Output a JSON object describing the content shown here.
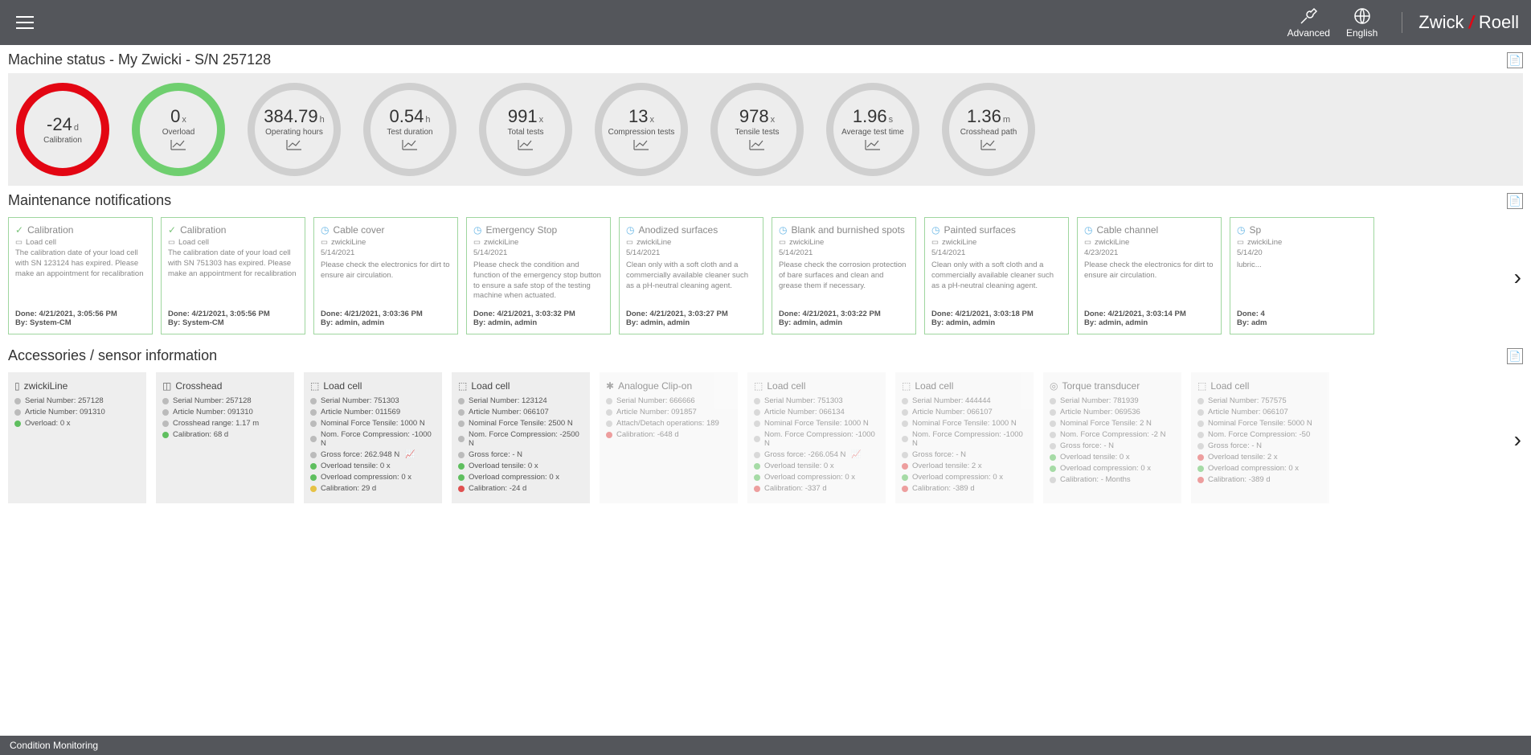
{
  "header": {
    "advanced": "Advanced",
    "language": "English",
    "logo_left": "Zwick",
    "logo_right": "Roell"
  },
  "status": {
    "title": "Machine status - My Zwicki - S/N 257128",
    "gauges": [
      {
        "value": "-24",
        "unit": "d",
        "label": "Calibration",
        "color": "red"
      },
      {
        "value": "0",
        "unit": "x",
        "label": "Overload",
        "color": "green",
        "icon": true
      },
      {
        "value": "384.79",
        "unit": "h",
        "label": "Operating hours",
        "color": "grey",
        "icon": true
      },
      {
        "value": "0.54",
        "unit": "h",
        "label": "Test duration",
        "color": "grey",
        "icon": true
      },
      {
        "value": "991",
        "unit": "x",
        "label": "Total tests",
        "color": "grey",
        "icon": true
      },
      {
        "value": "13",
        "unit": "x",
        "label": "Compression tests",
        "color": "grey",
        "icon": true
      },
      {
        "value": "978",
        "unit": "x",
        "label": "Tensile tests",
        "color": "grey",
        "icon": true
      },
      {
        "value": "1.96",
        "unit": "s",
        "label": "Average test time",
        "color": "grey",
        "icon": true
      },
      {
        "value": "1.36",
        "unit": "m",
        "label": "Crosshead path",
        "color": "grey",
        "icon": true
      }
    ]
  },
  "notifications": {
    "title": "Maintenance notifications",
    "items": [
      {
        "icon": "ok",
        "title": "Calibration",
        "sub": "Load cell",
        "date": "",
        "desc": "The calibration date of your load cell with SN 123124 has expired. Please make an appointment for recalibration",
        "done": "Done: 4/21/2021, 3:05:56 PM",
        "by": "By: System-CM"
      },
      {
        "icon": "ok",
        "title": "Calibration",
        "sub": "Load cell",
        "date": "",
        "desc": "The calibration date of your load cell with SN 751303 has expired. Please make an appointment for recalibration",
        "done": "Done: 4/21/2021, 3:05:56 PM",
        "by": "By: System-CM"
      },
      {
        "icon": "clock",
        "title": "Cable cover",
        "sub": "zwickiLine",
        "date": "5/14/2021",
        "desc": "Please check the electronics for dirt to ensure air circulation.",
        "done": "Done: 4/21/2021, 3:03:36 PM",
        "by": "By: admin, admin"
      },
      {
        "icon": "clock",
        "title": "Emergency Stop",
        "sub": "zwickiLine",
        "date": "5/14/2021",
        "desc": "Please check the condition and function of the emergency stop button to ensure a safe stop of the testing machine when actuated.",
        "done": "Done: 4/21/2021, 3:03:32 PM",
        "by": "By: admin, admin"
      },
      {
        "icon": "clock",
        "title": "Anodized surfaces",
        "sub": "zwickiLine",
        "date": "5/14/2021",
        "desc": "Clean only with a soft cloth and a commercially available cleaner such as a pH-neutral cleaning agent.",
        "done": "Done: 4/21/2021, 3:03:27 PM",
        "by": "By: admin, admin"
      },
      {
        "icon": "clock",
        "title": "Blank and burnished spots",
        "sub": "zwickiLine",
        "date": "5/14/2021",
        "desc": "Please check the corrosion protection of bare surfaces and clean and grease them if necessary.",
        "done": "Done: 4/21/2021, 3:03:22 PM",
        "by": "By: admin, admin"
      },
      {
        "icon": "clock",
        "title": "Painted surfaces",
        "sub": "zwickiLine",
        "date": "5/14/2021",
        "desc": "Clean only with a soft cloth and a commercially available cleaner such as a pH-neutral cleaning agent.",
        "done": "Done: 4/21/2021, 3:03:18 PM",
        "by": "By: admin, admin"
      },
      {
        "icon": "clock",
        "title": "Cable channel",
        "sub": "zwickiLine",
        "date": "4/23/2021",
        "desc": "Please check the electronics for dirt to ensure air circulation.",
        "done": "Done: 4/21/2021, 3:03:14 PM",
        "by": "By: admin, admin"
      },
      {
        "icon": "clock",
        "title": "Sp",
        "sub": "zwickiLine",
        "date": "5/14/20",
        "desc": "lubric...",
        "done": "Done: 4",
        "by": "By: adm"
      }
    ]
  },
  "accessories": {
    "title": "Accessories / sensor information",
    "items": [
      {
        "dim": false,
        "icon": "machine",
        "title": "zwickiLine",
        "rows": [
          {
            "c": "grey",
            "t": "Serial Number: 257128"
          },
          {
            "c": "grey",
            "t": "Article Number: 091310"
          },
          {
            "c": "green",
            "t": "Overload: 0 x"
          }
        ]
      },
      {
        "dim": false,
        "icon": "crosshead",
        "title": "Crosshead",
        "rows": [
          {
            "c": "grey",
            "t": "Serial Number: 257128"
          },
          {
            "c": "grey",
            "t": "Article Number: 091310"
          },
          {
            "c": "grey",
            "t": "Crosshead range: 1.17 m"
          },
          {
            "c": "green",
            "t": "Calibration: 68 d"
          }
        ]
      },
      {
        "dim": false,
        "icon": "loadcell",
        "title": "Load cell",
        "rows": [
          {
            "c": "grey",
            "t": "Serial Number: 751303"
          },
          {
            "c": "grey",
            "t": "Article Number: 011569"
          },
          {
            "c": "grey",
            "t": "Nominal Force Tensile: 1000 N"
          },
          {
            "c": "grey",
            "t": "Nom. Force Compression: -1000 N"
          },
          {
            "c": "grey",
            "t": "Gross force: 262.948 N",
            "chart": true
          },
          {
            "c": "green",
            "t": "Overload tensile: 0 x"
          },
          {
            "c": "green",
            "t": "Overload compression: 0 x"
          },
          {
            "c": "yellow",
            "t": "Calibration: 29 d"
          }
        ]
      },
      {
        "dim": false,
        "icon": "loadcell",
        "title": "Load cell",
        "rows": [
          {
            "c": "grey",
            "t": "Serial Number: 123124"
          },
          {
            "c": "grey",
            "t": "Article Number: 066107"
          },
          {
            "c": "grey",
            "t": "Nominal Force Tensile: 2500 N"
          },
          {
            "c": "grey",
            "t": "Nom. Force Compression: -2500 N"
          },
          {
            "c": "grey",
            "t": "Gross force: - N"
          },
          {
            "c": "green",
            "t": "Overload tensile: 0 x"
          },
          {
            "c": "green",
            "t": "Overload compression: 0 x"
          },
          {
            "c": "red",
            "t": "Calibration: -24 d"
          }
        ]
      },
      {
        "dim": true,
        "icon": "clipon",
        "title": "Analogue Clip-on",
        "rows": [
          {
            "c": "grey",
            "t": "Serial Number: 666666"
          },
          {
            "c": "grey",
            "t": "Article Number: 091857"
          },
          {
            "c": "grey",
            "t": "Attach/Detach operations: 189"
          },
          {
            "c": "red",
            "t": "Calibration: -648 d"
          }
        ]
      },
      {
        "dim": true,
        "icon": "loadcell",
        "title": "Load cell",
        "rows": [
          {
            "c": "grey",
            "t": "Serial Number: 751303"
          },
          {
            "c": "grey",
            "t": "Article Number: 066134"
          },
          {
            "c": "grey",
            "t": "Nominal Force Tensile: 1000 N"
          },
          {
            "c": "grey",
            "t": "Nom. Force Compression: -1000 N"
          },
          {
            "c": "grey",
            "t": "Gross force: -266.054 N",
            "chart": true
          },
          {
            "c": "green",
            "t": "Overload tensile: 0 x"
          },
          {
            "c": "green",
            "t": "Overload compression: 0 x"
          },
          {
            "c": "red",
            "t": "Calibration: -337 d"
          }
        ]
      },
      {
        "dim": true,
        "icon": "loadcell",
        "title": "Load cell",
        "rows": [
          {
            "c": "grey",
            "t": "Serial Number: 444444"
          },
          {
            "c": "grey",
            "t": "Article Number: 066107"
          },
          {
            "c": "grey",
            "t": "Nominal Force Tensile: 1000 N"
          },
          {
            "c": "grey",
            "t": "Nom. Force Compression: -1000 N"
          },
          {
            "c": "grey",
            "t": "Gross force: - N"
          },
          {
            "c": "red",
            "t": "Overload tensile: 2 x"
          },
          {
            "c": "green",
            "t": "Overload compression: 0 x"
          },
          {
            "c": "red",
            "t": "Calibration: -389 d"
          }
        ]
      },
      {
        "dim": true,
        "icon": "torque",
        "title": "Torque transducer",
        "rows": [
          {
            "c": "grey",
            "t": "Serial Number: 781939"
          },
          {
            "c": "grey",
            "t": "Article Number: 069536"
          },
          {
            "c": "grey",
            "t": "Nominal Force Tensile: 2 N"
          },
          {
            "c": "grey",
            "t": "Nom. Force Compression: -2 N"
          },
          {
            "c": "grey",
            "t": "Gross force: - N"
          },
          {
            "c": "green",
            "t": "Overload tensile: 0 x"
          },
          {
            "c": "green",
            "t": "Overload compression: 0 x"
          },
          {
            "c": "grey",
            "t": "Calibration: - Months"
          }
        ]
      },
      {
        "dim": true,
        "icon": "loadcell",
        "title": "Load cell",
        "rows": [
          {
            "c": "grey",
            "t": "Serial Number: 757575"
          },
          {
            "c": "grey",
            "t": "Article Number: 066107"
          },
          {
            "c": "grey",
            "t": "Nominal Force Tensile: 5000 N"
          },
          {
            "c": "grey",
            "t": "Nom. Force Compression: -50"
          },
          {
            "c": "grey",
            "t": "Gross force: - N"
          },
          {
            "c": "red",
            "t": "Overload tensile: 2 x"
          },
          {
            "c": "green",
            "t": "Overload compression: 0 x"
          },
          {
            "c": "red",
            "t": "Calibration: -389 d"
          }
        ]
      }
    ]
  },
  "footer": "Condition Monitoring"
}
